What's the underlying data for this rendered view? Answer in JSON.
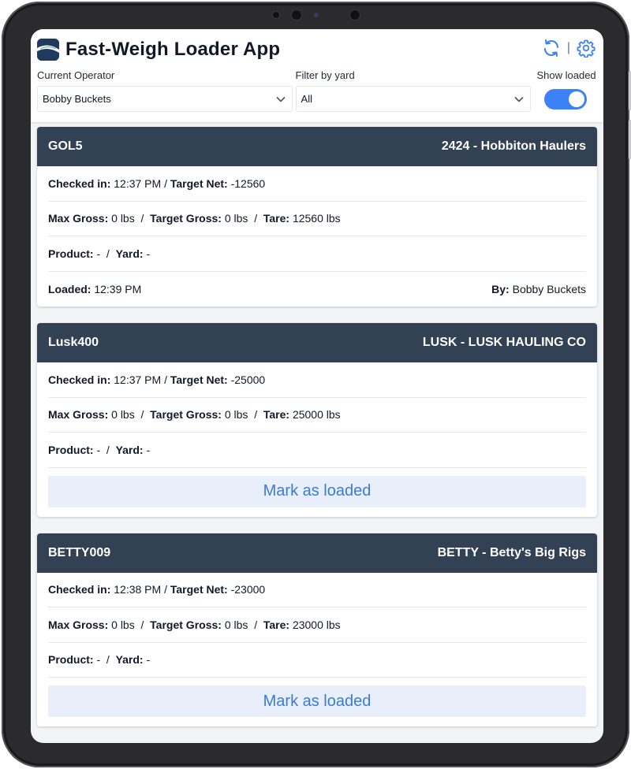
{
  "app": {
    "title": "Fast-Weigh Loader App",
    "separator": "|"
  },
  "filters": {
    "operator_label": "Current Operator",
    "operator_value": "Bobby Buckets",
    "yard_label": "Filter by yard",
    "yard_value": "All",
    "show_loaded_label": "Show loaded",
    "show_loaded_on": true
  },
  "labels": {
    "checked_in": "Checked in:",
    "target_net": "Target Net:",
    "max_gross": "Max Gross:",
    "target_gross": "Target Gross:",
    "tare": "Tare:",
    "product": "Product:",
    "yard": "Yard:",
    "loaded": "Loaded:",
    "by": "By:",
    "mark_loaded": "Mark as loaded",
    "slash": "/"
  },
  "tickets": [
    {
      "truck": "GOL5",
      "hauler": "2424 - Hobbiton Haulers",
      "checked_in": "12:37 PM",
      "target_net": "-12560",
      "max_gross": "0 lbs",
      "target_gross": "0 lbs",
      "tare": "12560 lbs",
      "product": "-",
      "yard": "-",
      "loaded_time": "12:39 PM",
      "loaded_by": "Bobby Buckets"
    },
    {
      "truck": "Lusk400",
      "hauler": "LUSK - LUSK HAULING CO",
      "checked_in": "12:37 PM",
      "target_net": "-25000",
      "max_gross": "0 lbs",
      "target_gross": "0 lbs",
      "tare": "25000 lbs",
      "product": "-",
      "yard": "-"
    },
    {
      "truck": "BETTY009",
      "hauler": "BETTY - Betty's Big Rigs",
      "checked_in": "12:38 PM",
      "target_net": "-23000",
      "max_gross": "0 lbs",
      "target_gross": "0 lbs",
      "tare": "23000 lbs",
      "product": "-",
      "yard": "-"
    }
  ],
  "colors": {
    "card_header": "#334155",
    "accent": "#3b82f6",
    "button_bg": "#e8effb",
    "button_text": "#3b7bd8"
  },
  "icons": {
    "refresh": "refresh-icon",
    "settings": "gear-icon",
    "dropdown": "chevron-down-icon",
    "logo": "app-logo"
  }
}
